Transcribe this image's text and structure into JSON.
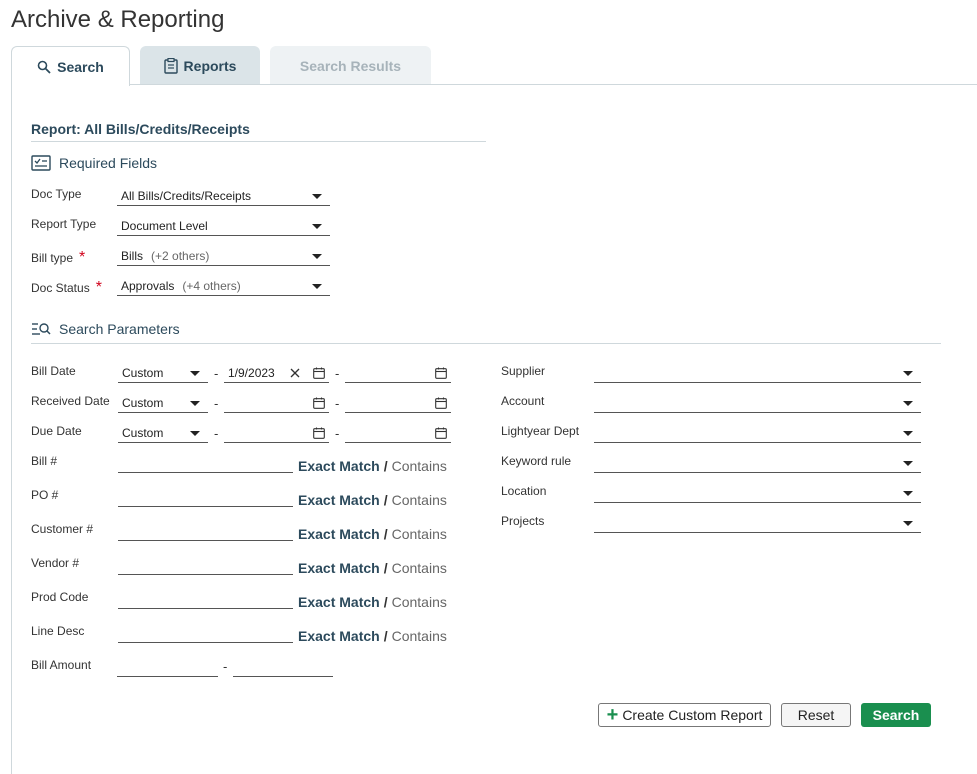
{
  "page": {
    "title": "Archive & Reporting"
  },
  "tabs": [
    {
      "label": "Search",
      "icon": "search-icon",
      "state": "active"
    },
    {
      "label": "Reports",
      "icon": "clipboard-icon",
      "state": "inactive"
    },
    {
      "label": "Search Results",
      "state": "disabled"
    }
  ],
  "report": {
    "title": "Report: All Bills/Credits/Receipts"
  },
  "required": {
    "title": "Required Fields",
    "fields": [
      {
        "label": "Doc Type",
        "value": "All Bills/Credits/Receipts",
        "extra": "",
        "required": false
      },
      {
        "label": "Report Type",
        "value": "Document Level",
        "extra": "",
        "required": false
      },
      {
        "label": "Bill type",
        "value": "Bills",
        "extra": "(+2 others)",
        "required": true
      },
      {
        "label": "Doc Status",
        "value": "Approvals",
        "extra": "(+4 others)",
        "required": true
      }
    ],
    "required_marker": "*"
  },
  "search_params": {
    "title": "Search Parameters",
    "date_fields": [
      {
        "label": "Bill Date",
        "range": "Custom",
        "from": "1/9/2023",
        "to": ""
      },
      {
        "label": "Received Date",
        "range": "Custom",
        "from": "",
        "to": ""
      },
      {
        "label": "Due Date",
        "range": "Custom",
        "from": "",
        "to": ""
      }
    ],
    "text_fields": [
      {
        "label": "Bill #",
        "value": ""
      },
      {
        "label": "PO #",
        "value": ""
      },
      {
        "label": "Customer #",
        "value": ""
      },
      {
        "label": "Vendor #",
        "value": ""
      },
      {
        "label": "Prod Code",
        "value": ""
      },
      {
        "label": "Line Desc",
        "value": ""
      }
    ],
    "match": {
      "exact": "Exact Match",
      "separator": "/",
      "contains": "Contains"
    },
    "amount": {
      "label": "Bill Amount",
      "min": "",
      "max": ""
    },
    "dash": "-",
    "right_fields": [
      {
        "label": "Supplier",
        "value": ""
      },
      {
        "label": "Account",
        "value": ""
      },
      {
        "label": "Lightyear Dept",
        "value": ""
      },
      {
        "label": "Keyword rule",
        "value": ""
      },
      {
        "label": "Location",
        "value": ""
      },
      {
        "label": "Projects",
        "value": ""
      }
    ]
  },
  "buttons": {
    "create_custom": "Create Custom Report",
    "create_icon": "+",
    "reset": "Reset",
    "search": "Search"
  },
  "colors": {
    "accent": "#2c4a5c",
    "primary_button": "#1a8f4f",
    "required": "#d0021b"
  }
}
